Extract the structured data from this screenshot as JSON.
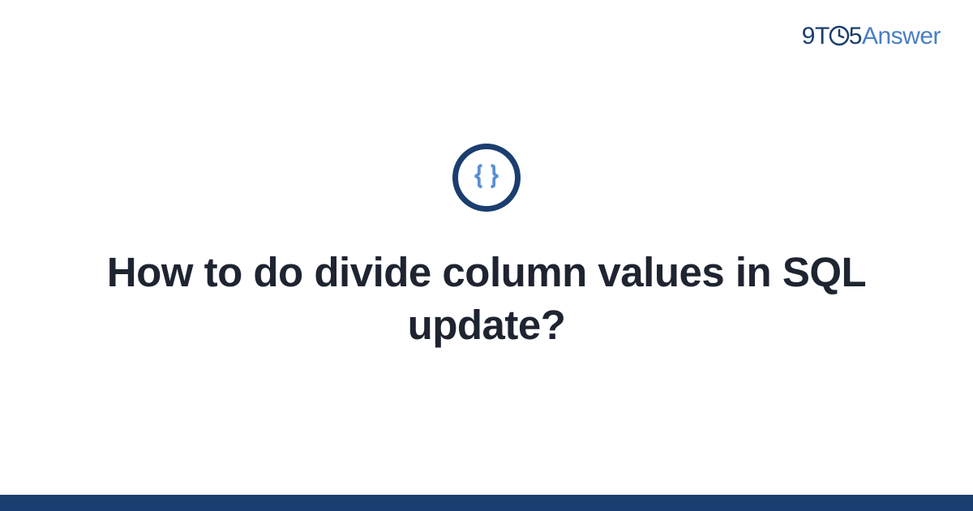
{
  "brand": {
    "part1": "9",
    "part2": "T",
    "part3": "5",
    "part4": "Answer"
  },
  "icon": {
    "name": "code-braces"
  },
  "title": "How to do divide column values in SQL update?",
  "colors": {
    "brand_dark": "#1a3e6f",
    "brand_light": "#4a7fc4",
    "text": "#1e2430"
  }
}
